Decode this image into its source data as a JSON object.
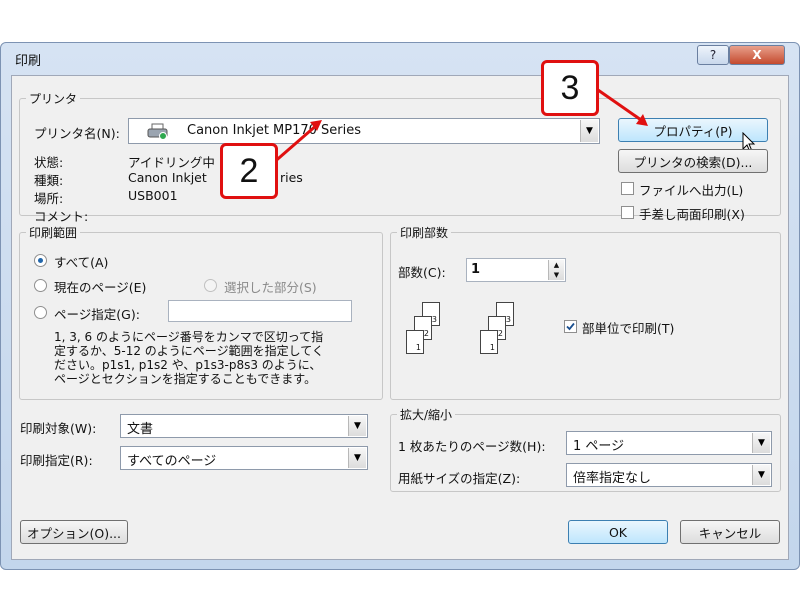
{
  "window": {
    "title": "印刷",
    "help_label": "?",
    "close_label": "X"
  },
  "printer": {
    "group_label": "プリンタ",
    "name_label": "プリンタ名(N):",
    "name_value": "Canon Inkjet MP170 Series",
    "status_label": "状態:",
    "status_value": "アイドリング中",
    "type_label": "種類:",
    "type_value_a": "Canon Inkjet",
    "type_value_b": "ries",
    "location_label": "場所:",
    "location_value": "USB001",
    "comment_label": "コメント:",
    "properties_button": "プロパティ(P)",
    "find_button": "プリンタの検索(D)...",
    "print_to_file": "ファイルへ出力(L)",
    "manual_duplex": "手差し両面印刷(X)"
  },
  "print_range": {
    "group_label": "印刷範囲",
    "all": "すべて(A)",
    "current_page": "現在のページ(E)",
    "selection": "選択した部分(S)",
    "pages": "ページ指定(G):",
    "description": [
      "1, 3, 6 のようにページ番号をカンマで区切って指",
      "定するか、5-12 のようにページ範囲を指定してく",
      "ださい。p1s1, p1s2 や、p1s3-p8s3 のように、",
      "ページとセクションを指定することもできます。"
    ]
  },
  "copies": {
    "group_label": "印刷部数",
    "count_label": "部数(C):",
    "count_value": "1",
    "collate": "部単位で印刷(T)",
    "collate_checked": true,
    "page_numbers": [
      "1",
      "2",
      "3"
    ]
  },
  "print_what": {
    "label": "印刷対象(W):",
    "value": "文書"
  },
  "print_option": {
    "label": "印刷指定(R):",
    "value": "すべてのページ"
  },
  "zoom": {
    "group_label": "拡大/縮小",
    "pages_per_sheet_label": "1 枚あたりのページ数(H):",
    "pages_per_sheet_value": "1 ページ",
    "scale_label": "用紙サイズの指定(Z):",
    "scale_value": "倍率指定なし"
  },
  "footer": {
    "options_button": "オプション(O)...",
    "ok_button": "OK",
    "cancel_button": "キャンセル"
  },
  "callouts": {
    "two": "2",
    "three": "3"
  },
  "colors": {
    "callout_border": "#e01010",
    "dialog_bg": "#f0f0f0",
    "frame": "#c3d6ec"
  },
  "icons": {
    "printer": "printer-icon",
    "dropdown": "chevron-down-icon",
    "spin": "spin-arrows-icon",
    "cursor": "mouse-pointer-icon"
  }
}
